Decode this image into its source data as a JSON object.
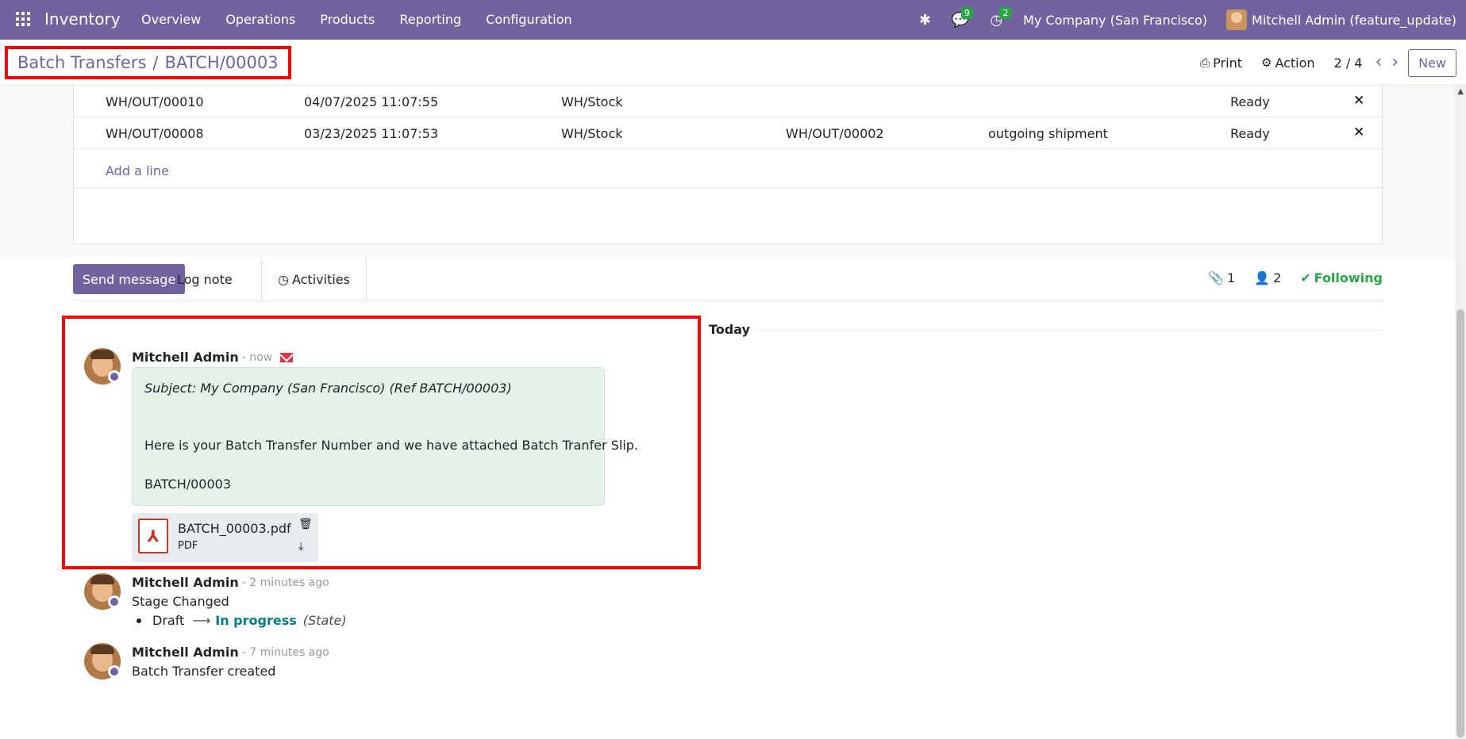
{
  "navbar": {
    "brand": "Inventory",
    "menu": [
      "Overview",
      "Operations",
      "Products",
      "Reporting",
      "Configuration"
    ],
    "messages_count": "9",
    "activities_count": "2",
    "company": "My Company (San Francisco)",
    "user": "Mitchell Admin (feature_update)"
  },
  "control": {
    "breadcrumb_parent": "Batch Transfers",
    "breadcrumb_sep": "/",
    "breadcrumb_current": "BATCH/00003",
    "print": "Print",
    "action": "Action",
    "pager": "2 / 4",
    "new": "New"
  },
  "transfers": {
    "rows": [
      {
        "ref": "WH/OUT/00010",
        "date": "04/07/2025 11:07:55",
        "source": "WH/Stock",
        "backorder": "",
        "operation": "",
        "status": "Ready"
      },
      {
        "ref": "WH/OUT/00008",
        "date": "03/23/2025 11:07:53",
        "source": "WH/Stock",
        "backorder": "WH/OUT/00002",
        "operation": "outgoing shipment",
        "status": "Ready"
      }
    ],
    "add_line": "Add a line"
  },
  "chatter": {
    "send_message": "Send message",
    "log_note": "Log note",
    "activities": "Activities",
    "attachments_count": "1",
    "followers_count": "2",
    "following": "Following",
    "today": "Today",
    "messages": [
      {
        "author": "Mitchell Admin",
        "time": "- now",
        "subject": "Subject: My Company (San Francisco) (Ref BATCH/00003)",
        "body_1": "Here is your Batch Transfer Number and we have attached Batch Tranfer Slip.",
        "body_2": "BATCH/00003",
        "attachment_name": "BATCH_00003.pdf",
        "attachment_type": "PDF"
      },
      {
        "author": "Mitchell Admin",
        "time": "- 2 minutes ago",
        "text": "Stage Changed",
        "old_value": "Draft",
        "new_value": "In progress",
        "field": "(State)"
      },
      {
        "author": "Mitchell Admin",
        "time": "- 7 minutes ago",
        "text": "Batch Transfer created"
      }
    ]
  }
}
